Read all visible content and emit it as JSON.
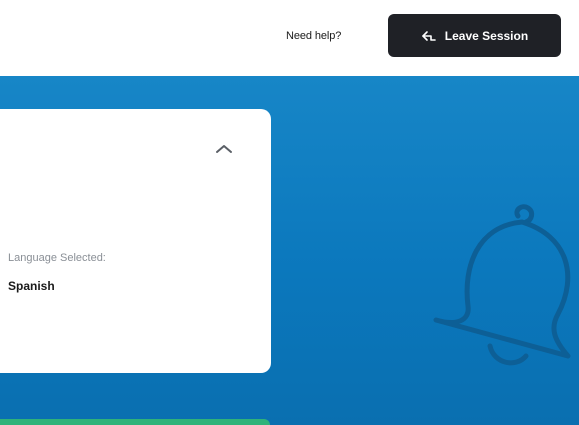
{
  "header": {
    "help_label": "Need help?",
    "leave_label": "Leave Session",
    "leave_icon": "leave-arrow-icon"
  },
  "card": {
    "language_label": "Language Selected:",
    "language_value": "Spanish",
    "collapse_icon": "chevron-up-icon"
  },
  "decoration": {
    "bell_icon": "bell-icon"
  },
  "colors": {
    "panel_blue": "#0b78bd",
    "button_dark": "#1f2126",
    "accent_green": "#2fb37a"
  }
}
